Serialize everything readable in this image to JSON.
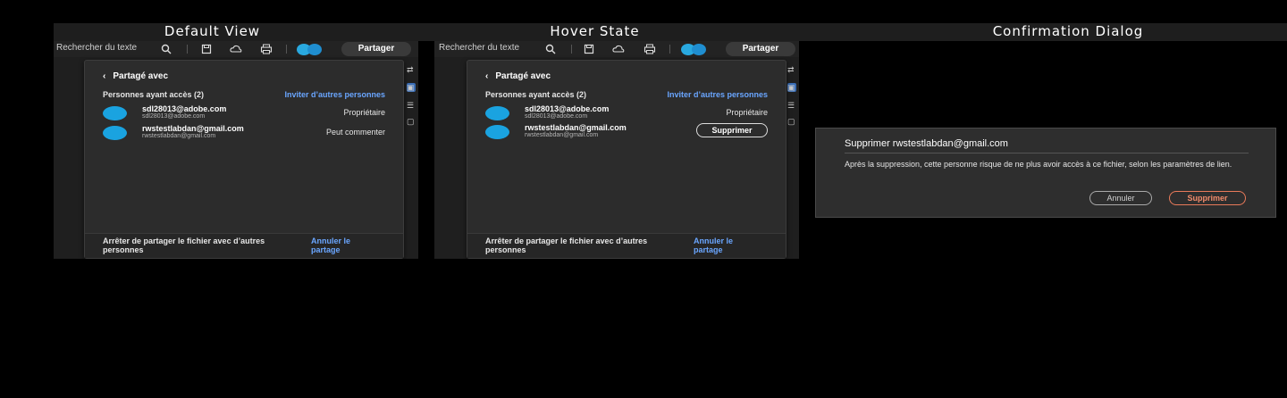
{
  "sections": {
    "default": "Default View",
    "hover": "Hover State",
    "confirm": "Confirmation Dialog"
  },
  "toolbar": {
    "search_label": "Rechercher du texte",
    "share_label": "Partager",
    "icons": [
      "search-icon",
      "save-icon",
      "cloud-icon",
      "print-icon"
    ]
  },
  "share_panel": {
    "title": "Partagé avec",
    "people_heading": "Personnes ayant accès (2)",
    "invite_link": "Inviter d’autres personnes",
    "people": [
      {
        "email": "sdl28013@adobe.com",
        "subtext": "sdl28013@adobe.com",
        "role": "Propriétaire"
      },
      {
        "email": "rwstestlabdan@gmail.com",
        "subtext": "rwstestlabdan@gmail.com",
        "role": "Peut commenter"
      }
    ],
    "hover_action": "Supprimer",
    "footer_text": "Arrêter de partager le fichier avec d’autres personnes",
    "footer_link": "Annuler le partage",
    "accent_color": "#6aa6ff",
    "avatar_color": "#1aa3e0"
  },
  "dialog": {
    "title": "Supprimer rwstestlabdan@gmail.com",
    "body": "Après la suppression, cette personne risque de ne plus avoir accès à ce fichier, selon les paramètres de lien.",
    "cancel_label": "Annuler",
    "confirm_label": "Supprimer",
    "confirm_color": "#e97a5a"
  }
}
